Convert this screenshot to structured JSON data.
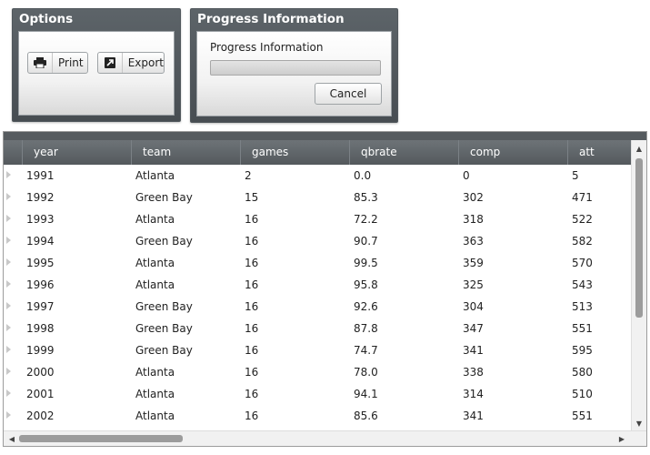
{
  "options": {
    "title": "Options",
    "print_label": "Print",
    "export_label": "Export"
  },
  "progress": {
    "title": "Progress Information",
    "label": "Progress Information",
    "value": 0,
    "cancel_label": "Cancel"
  },
  "grid": {
    "columns": [
      "year",
      "team",
      "games",
      "qbrate",
      "comp",
      "att"
    ],
    "rows": [
      [
        "1991",
        "Atlanta",
        "2",
        "0.0",
        "0",
        "5"
      ],
      [
        "1992",
        "Green Bay",
        "15",
        "85.3",
        "302",
        "471"
      ],
      [
        "1993",
        "Atlanta",
        "16",
        "72.2",
        "318",
        "522"
      ],
      [
        "1994",
        "Green Bay",
        "16",
        "90.7",
        "363",
        "582"
      ],
      [
        "1995",
        "Atlanta",
        "16",
        "99.5",
        "359",
        "570"
      ],
      [
        "1996",
        "Atlanta",
        "16",
        "95.8",
        "325",
        "543"
      ],
      [
        "1997",
        "Green Bay",
        "16",
        "92.6",
        "304",
        "513"
      ],
      [
        "1998",
        "Green Bay",
        "16",
        "87.8",
        "347",
        "551"
      ],
      [
        "1999",
        "Green Bay",
        "16",
        "74.7",
        "341",
        "595"
      ],
      [
        "2000",
        "Atlanta",
        "16",
        "78.0",
        "338",
        "580"
      ],
      [
        "2001",
        "Atlanta",
        "16",
        "94.1",
        "314",
        "510"
      ],
      [
        "2002",
        "Atlanta",
        "16",
        "85.6",
        "341",
        "551"
      ]
    ]
  },
  "icons": {
    "print": "printer-icon",
    "export": "export-icon",
    "row_marker": "row-indicator-icon"
  },
  "colors": {
    "panel_header": "#4f565b",
    "grid_header": "#5f6569",
    "progress_fill": "#5bb35b"
  }
}
